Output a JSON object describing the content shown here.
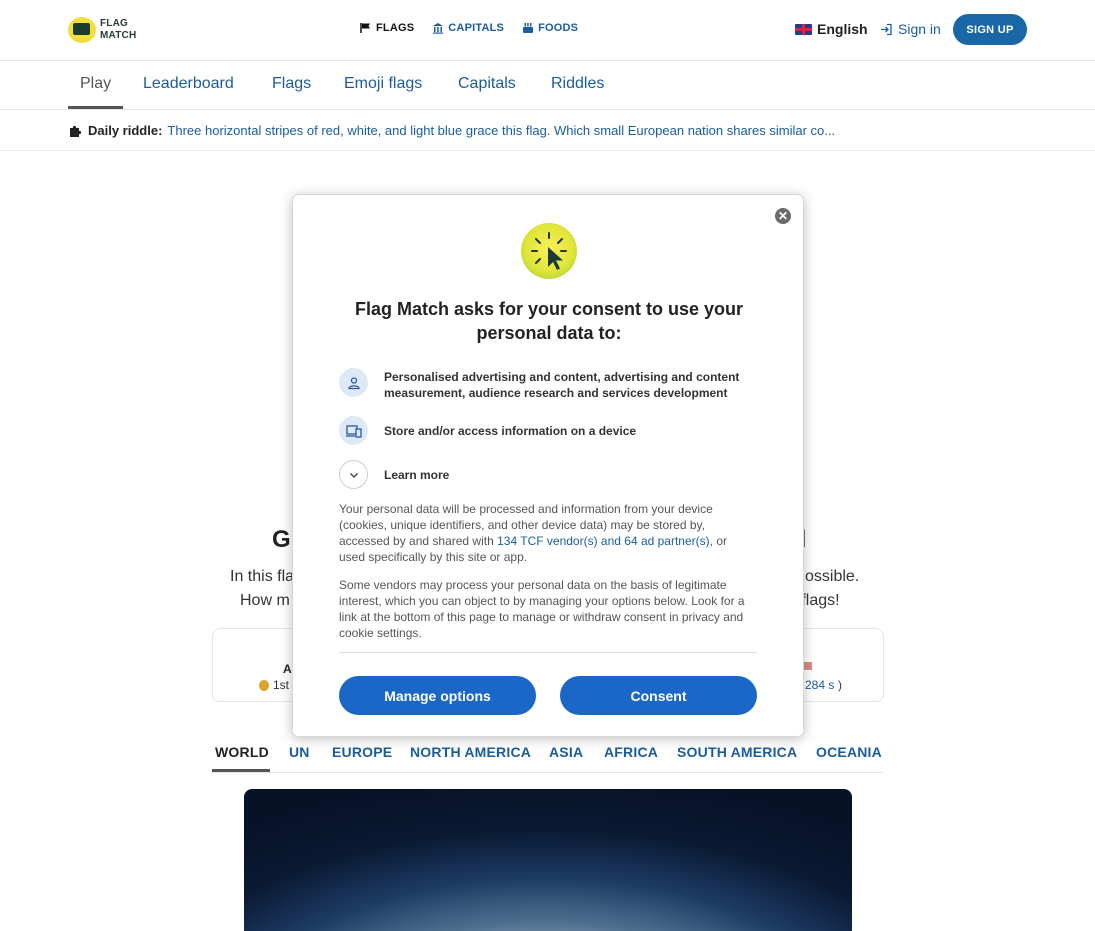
{
  "header": {
    "logo_line1": "FLAG",
    "logo_line2": "MATCH",
    "nav": [
      {
        "label": "FLAGS",
        "icon": "flag-icon"
      },
      {
        "label": "CAPITALS",
        "icon": "building-icon"
      },
      {
        "label": "FOODS",
        "icon": "food-icon"
      }
    ],
    "language": "English",
    "sign_in": "Sign in",
    "sign_up": "SIGN UP"
  },
  "tabs": [
    "Play",
    "Leaderboard",
    "Flags",
    "Emoji flags",
    "Capitals",
    "Riddles"
  ],
  "riddle": {
    "label": "Daily riddle:",
    "text": "Three horizontal stripes of red, white, and light blue grace this flag. Which small European nation shares similar co..."
  },
  "background": {
    "title_start": "G",
    "title_end": "ld",
    "line1_start": "In this fla",
    "line1_end": "ossible.",
    "line2_start": "How m",
    "line2_end": "d flags!",
    "stats_left_1": "A",
    "stats_left_2": "1st",
    "stats_right": "284 s",
    "regions": [
      "WORLD",
      "UN",
      "EUROPE",
      "NORTH AMERICA",
      "ASIA",
      "AFRICA",
      "SOUTH AMERICA",
      "OCEANIA"
    ]
  },
  "consent": {
    "title": "Flag Match asks for your consent to use your personal data to:",
    "purposes": [
      {
        "icon": "person-icon",
        "text": "Personalised advertising and content, advertising and content measurement, audience research and services development"
      },
      {
        "icon": "device-icon",
        "text": "Store and/or access information on a device"
      },
      {
        "icon": "chevron-down-icon",
        "text": "Learn more"
      }
    ],
    "para1_a": "Your personal data will be processed and information from your device (cookies, unique identifiers, and other device data) may be stored by, accessed by and shared with ",
    "para1_link": "134 TCF vendor(s) and 64 ad partner(s)",
    "para1_b": ", or used specifically by this site or app.",
    "para2": "Some vendors may process your personal data on the basis of legitimate interest, which you can object to by managing your options below. Look for a link at the bottom of this page to manage or withdraw consent in privacy and cookie settings.",
    "manage_label": "Manage options",
    "consent_label": "Consent",
    "close_label": "✕"
  },
  "colors": {
    "link_blue": "#1a5c9c",
    "button_blue": "#1a67c8",
    "signup_blue": "#1a67a8"
  }
}
